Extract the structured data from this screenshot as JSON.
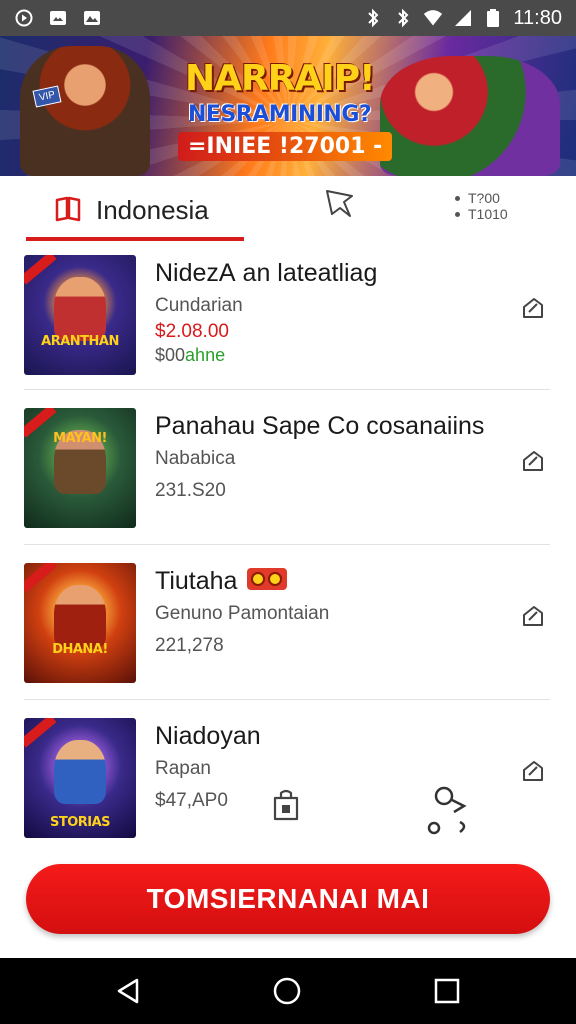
{
  "status_bar": {
    "time": "11:80",
    "icons": [
      "record-icon",
      "image-icon",
      "gallery-icon",
      "bluetooth-icon",
      "vibrate-icon",
      "wifi-icon",
      "signal-icon",
      "battery-icon"
    ]
  },
  "banner": {
    "headline": "NARRAIP!",
    "subline": "NESRAMINING?",
    "dateline": "=INIEE !27001 -",
    "tag": "VIP"
  },
  "tabs": {
    "region_label": "Indonesia",
    "stat_top": "T?00",
    "stat_bottom": "T1010",
    "colors": {
      "accent": "#d81b1b"
    }
  },
  "items": [
    {
      "title": "NidezА an lateatliag",
      "subtitle": "Cundarian",
      "price": "$2.08.00",
      "price2_prefix": "$00",
      "price2_green": "ahne",
      "thumb_title": "ARANTHAN"
    },
    {
      "title": "Panahau Sape Co cosanaiins",
      "subtitle": "Nababica",
      "price": "231.S20",
      "thumb_title": "MAYAN!"
    },
    {
      "title": "Tiutaha",
      "subtitle": "Genuno Pamontaian",
      "price": "221,278",
      "thumb_title": "DHANA!"
    },
    {
      "title": "Niadoyan",
      "subtitle": "Rapan",
      "price": "$47,AP0",
      "thumb_title": "STORIAS"
    }
  ],
  "cta": {
    "label": "TOMSIERNANAI MAI"
  },
  "nav": {
    "back": "back-icon",
    "home": "home-icon",
    "recents": "recents-icon"
  }
}
